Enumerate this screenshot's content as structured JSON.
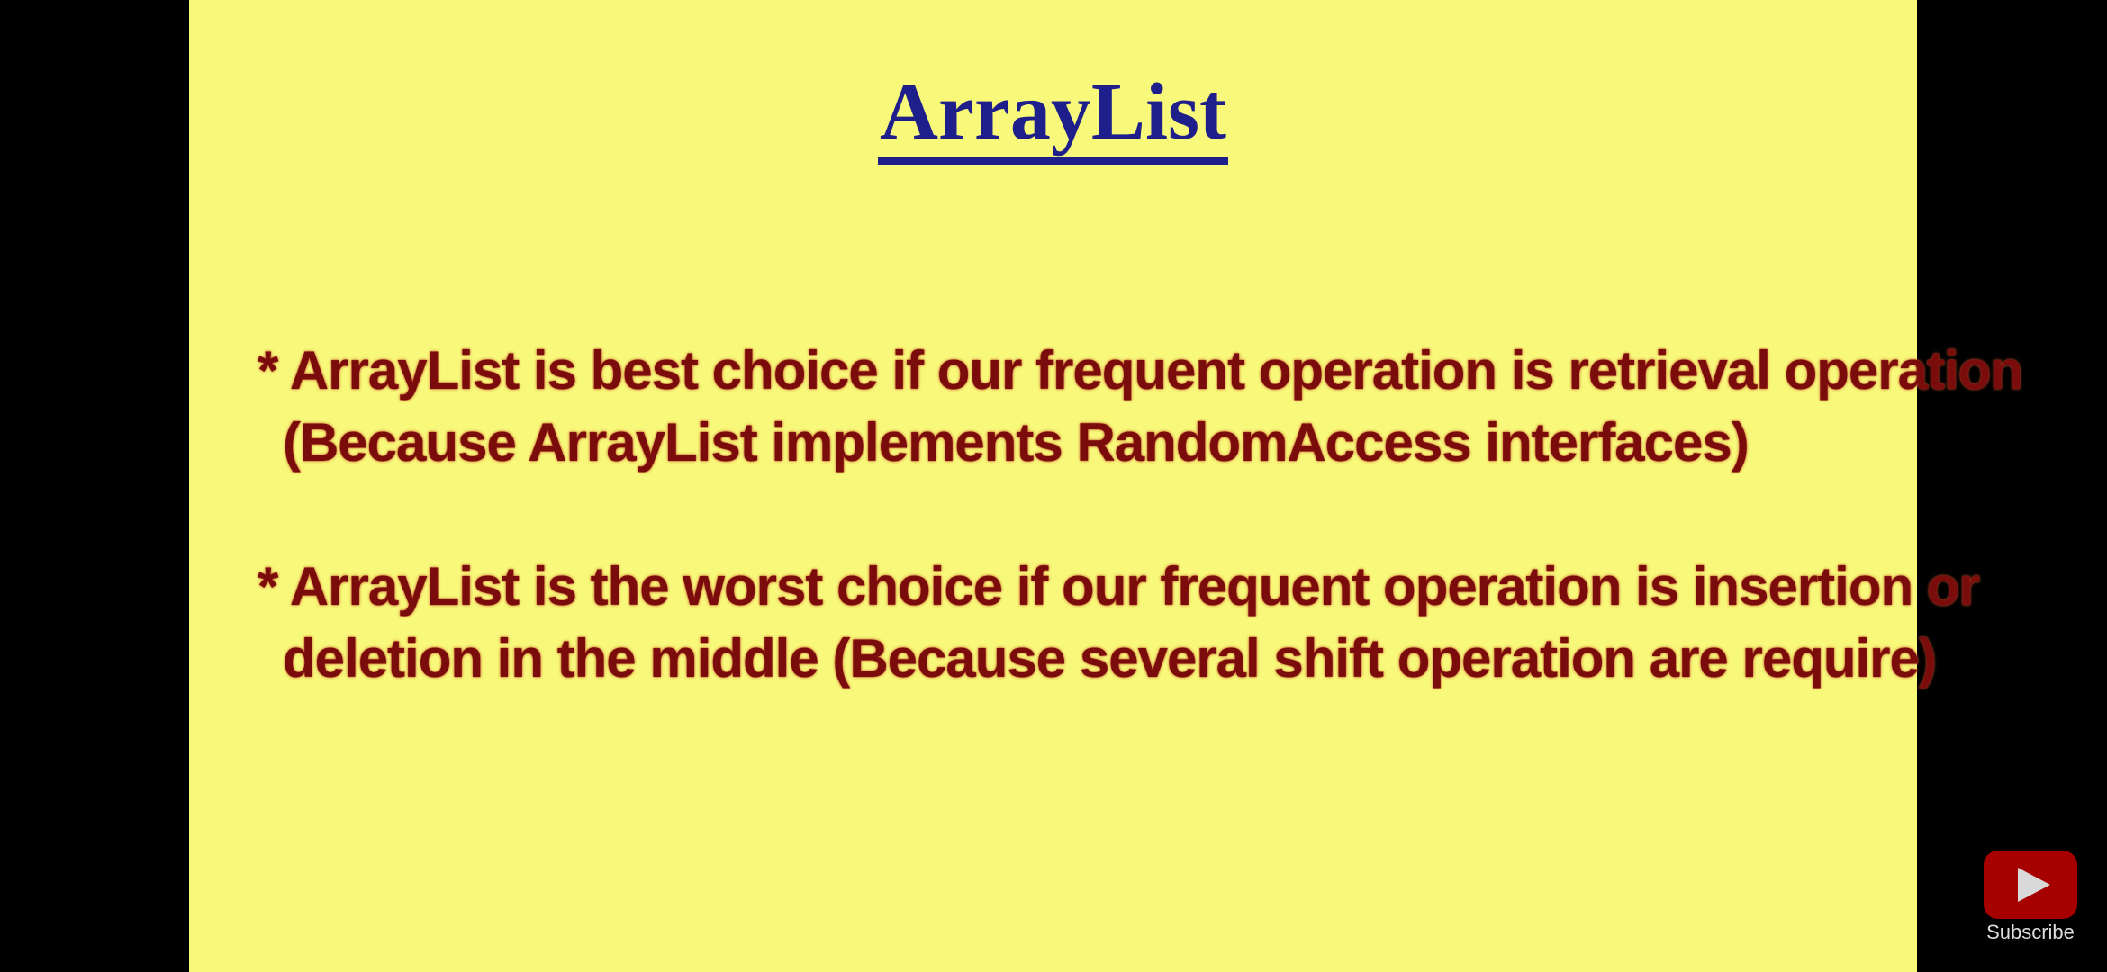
{
  "slide": {
    "title": "ArrayList",
    "bullets": [
      {
        "marker": "*",
        "line1": "ArrayList is best choice if our frequent operation is retrieval operation",
        "line2": "(Because ArrayList implements RandomAccess interfaces)"
      },
      {
        "marker": "*",
        "line1": "ArrayList is the worst choice if our frequent operation is insertion or",
        "line2": "deletion in the middle  (Because several shift operation are require)"
      }
    ],
    "colors": {
      "background": "#f8f87a",
      "title": "#1f1f8c",
      "body_text": "#7a0c0c",
      "letterbox": "#000000"
    }
  },
  "overlay": {
    "subscribe_label": "Subscribe",
    "icon": "play-icon",
    "accent": "#c40000"
  }
}
